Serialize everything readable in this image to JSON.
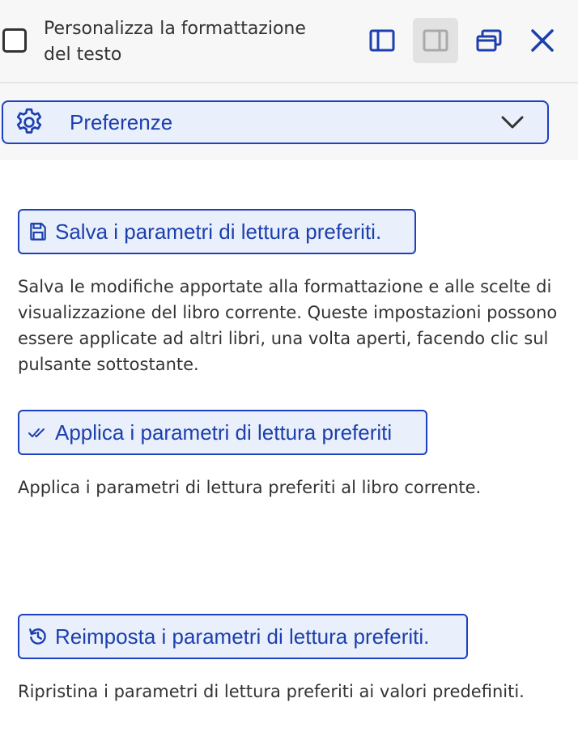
{
  "header": {
    "title": "Personalizza la formattazione del testo",
    "icons": [
      "sidebar-left-icon",
      "sidebar-right-icon",
      "windows-icon",
      "close-icon"
    ]
  },
  "preferences": {
    "label": "Preferenze",
    "icon": "gear-icon"
  },
  "actions": [
    {
      "label": "Salva i parametri di lettura preferiti.",
      "icon": "save-icon",
      "description": "Salva le modifiche apportate alla formattazione e alle scelte di visualizzazione del libro corrente. Queste impostazioni possono essere applicate ad altri libri, una volta aperti, facendo clic sul pulsante sottostante."
    },
    {
      "label": "Applica i parametri di lettura preferiti",
      "icon": "double-check-icon",
      "description": "Applica i parametri di lettura preferiti al libro corrente."
    },
    {
      "label": "Reimposta i parametri di lettura preferiti.",
      "icon": "history-icon",
      "description": "Ripristina i parametri di lettura preferiti ai valori predefiniti."
    }
  ],
  "colors": {
    "accent": "#1c3fae",
    "button_bg": "#eaf0fb",
    "header_bg": "#f7f7f7",
    "text": "#333333"
  }
}
